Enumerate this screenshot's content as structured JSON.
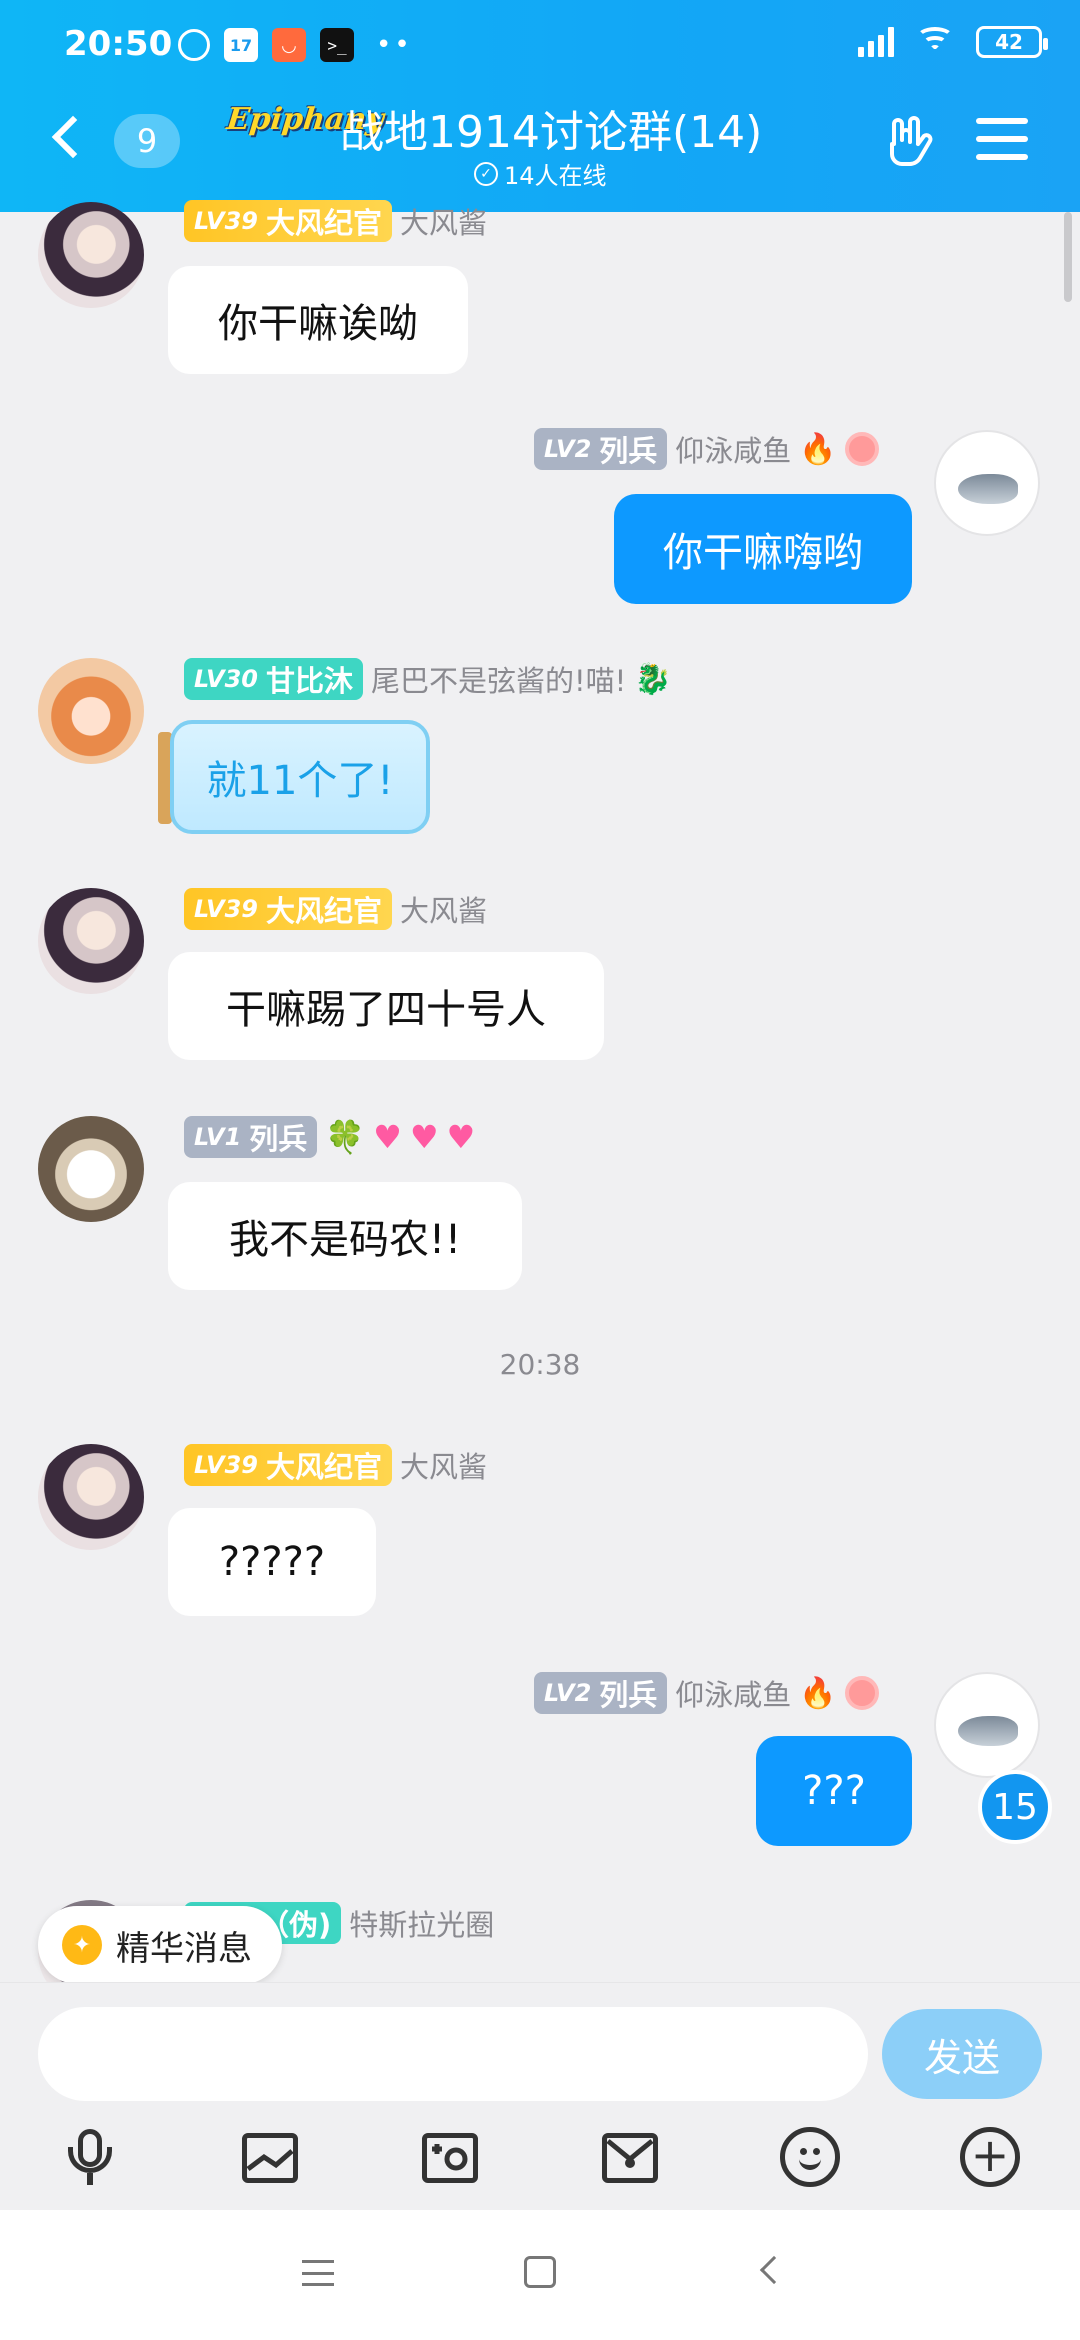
{
  "status_bar": {
    "time": "20:50",
    "calendar": "17",
    "battery": "42",
    "network": "HD"
  },
  "header": {
    "back_count": "9",
    "logo": "Epiphany",
    "title": "战地1914讨论群(14)",
    "online": "14人在线"
  },
  "messages": [
    {
      "level": "LV39",
      "rank": "大风纪官",
      "name": "大风酱",
      "text": "你干嘛诶呦"
    },
    {
      "level": "LV2",
      "rank": "列兵",
      "name": "仰泳咸鱼",
      "text": "你干嘛嗨哟"
    },
    {
      "level": "LV30",
      "rank": "甘比沐",
      "name": "尾巴不是弦酱的!喵!",
      "text": "就11个了!"
    },
    {
      "level": "LV39",
      "rank": "大风纪官",
      "name": "大风酱",
      "text": "干嘛踢了四十号人"
    },
    {
      "level": "LV1",
      "rank": "列兵",
      "name": "",
      "text": "我不是码农!!"
    },
    {
      "level": "LV39",
      "rank": "大风纪官",
      "name": "大风酱",
      "text": "?????"
    },
    {
      "level": "LV2",
      "rank": "列兵",
      "name": "仰泳咸鱼",
      "text": "???"
    },
    {
      "level": "",
      "rank": "群主（伪)",
      "name": "特斯拉光圈",
      "text": ""
    }
  ],
  "time_separator": "20:38",
  "unread_badge": "15",
  "essence_button": "精华消息",
  "input": {
    "placeholder": "",
    "send_label": "发送"
  },
  "icons": [
    "mic-icon",
    "image-icon",
    "camera-icon",
    "red-packet-icon",
    "emoji-icon",
    "plus-icon"
  ],
  "colors": {
    "header": "#12a7f6",
    "outgoing_bubble": "#0d99ff",
    "send_button": "#8ccff8"
  }
}
